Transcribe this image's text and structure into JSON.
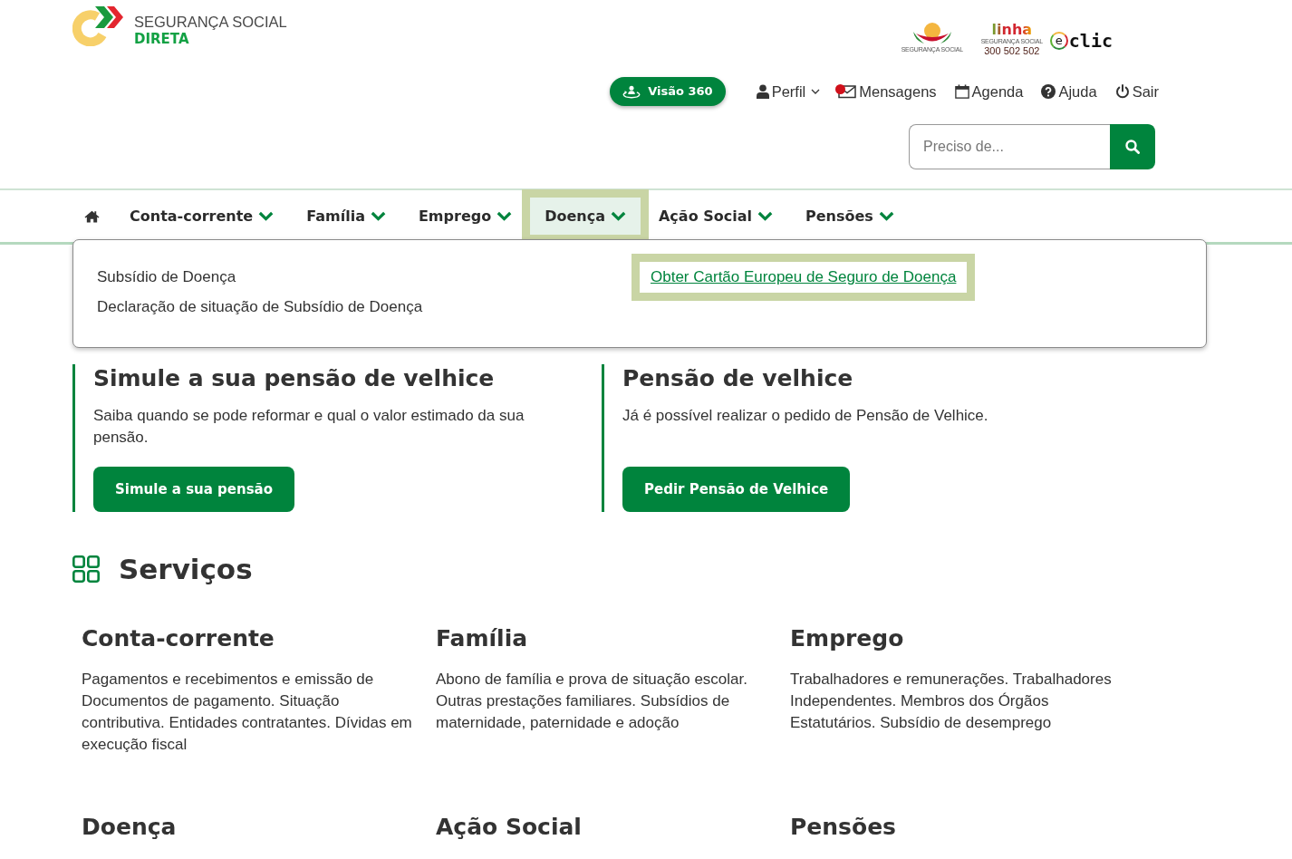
{
  "header": {
    "brand": {
      "line1": "SEGURANÇA SOCIAL",
      "line2": "DIRETA"
    },
    "partner_logos": [
      {
        "kind": "emblem",
        "caption": "SEGURANÇA SOCIAL"
      },
      {
        "kind": "phone_line",
        "title": "linha",
        "caption": "SEGURANÇA SOCIAL",
        "number": "300 502 502"
      },
      {
        "kind": "eclic",
        "badge": "e",
        "title": "clic"
      }
    ]
  },
  "user_nav": {
    "highlight_button": "Visão 360",
    "links": [
      {
        "kind": "profile",
        "label": "Perfil",
        "has_menu": true,
        "unread": false
      },
      {
        "kind": "messages",
        "label": "Mensagens",
        "has_menu": false,
        "unread": true
      },
      {
        "kind": "agenda",
        "label": "Agenda",
        "has_menu": false,
        "unread": false
      },
      {
        "kind": "help",
        "label": "Ajuda",
        "has_menu": false,
        "unread": false
      },
      {
        "kind": "logout",
        "label": "Sair",
        "has_menu": false,
        "unread": false
      }
    ]
  },
  "search": {
    "placeholder": "Preciso de..."
  },
  "main_nav": {
    "items": [
      {
        "kind": "home",
        "selected": false
      },
      {
        "kind": "menu",
        "label": "Conta-corrente",
        "selected": false
      },
      {
        "kind": "menu",
        "label": "Família",
        "selected": false
      },
      {
        "kind": "menu",
        "label": "Emprego",
        "selected": false
      },
      {
        "kind": "menu",
        "label": "Doença",
        "selected": true
      },
      {
        "kind": "menu",
        "label": "Ação Social",
        "selected": false
      },
      {
        "kind": "menu",
        "label": "Pensões",
        "selected": false
      }
    ],
    "open_menu": {
      "columns": [
        {
          "items": [
            {
              "label": "Subsídio de Doença",
              "focused": false
            },
            {
              "label": "Declaração de situação de Subsídio de Doença",
              "focused": false
            }
          ]
        },
        {
          "items": [
            {
              "label": "Obter Cartão Europeu de Seguro de Doença",
              "focused": true
            }
          ]
        }
      ]
    }
  },
  "promos": [
    {
      "title": "Simule a sua pensão de velhice",
      "text": "Saiba quando se pode reformar e qual o valor estimado da sua pensão.",
      "button": "Simule a sua pensão"
    },
    {
      "title": "Pensão de velhice",
      "text": "Já é possível realizar o pedido de Pensão de Velhice.",
      "button": "Pedir Pensão de Velhice"
    }
  ],
  "services": {
    "title": "Serviços",
    "items": [
      {
        "title": "Conta-corrente",
        "description": "Pagamentos e recebimentos e emissão de Documentos de pagamento. Situação contributiva. Entidades contratantes. Dívidas em execução fiscal"
      },
      {
        "title": "Família",
        "description": "Abono de família e prova de situação escolar. Outras prestações familiares. Subsídios de maternidade, paternidade e adoção"
      },
      {
        "title": "Emprego",
        "description": "Trabalhadores e remunerações. Trabalhadores Independentes. Membros dos Órgãos Estatutários. Subsídio de desemprego"
      },
      {
        "title": "Doença"
      },
      {
        "title": "Ação Social"
      },
      {
        "title": "Pensões"
      }
    ]
  }
}
